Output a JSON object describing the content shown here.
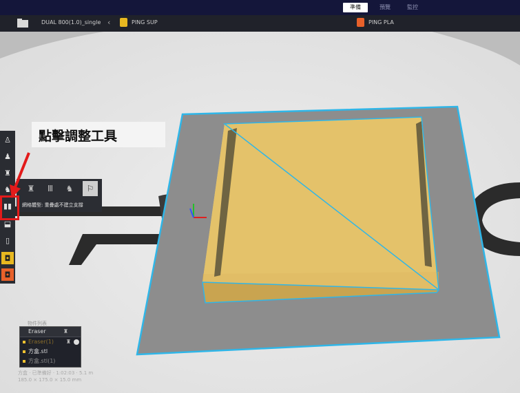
{
  "stage_tabs": [
    "準備",
    "預覽",
    "監控"
  ],
  "printer_name": "DUAL 800(1.0)_single",
  "materials": [
    {
      "label": "PING SUP",
      "color": "#e8b820"
    },
    {
      "label": "PING PLA",
      "color": "#e8612a"
    }
  ],
  "callout_text": "點擊調整工具",
  "support_tool_label": "網格體型: 重疊處不建立支撐",
  "object_list": {
    "title": "物件列表",
    "header": "Eraser",
    "items": [
      "Eraser(1)",
      "方盒.stl",
      "方盒.stl(1)"
    ]
  },
  "status_lines": [
    "方盒 · 已準備好 · 1:02:03 · 5.1 m",
    "185.0 × 175.0 × 15.0 mm"
  ],
  "colors": {
    "model": "#e3c068",
    "selection": "#2fb6e8",
    "plate": "#8d8d8d",
    "highlight": "#e31b1b",
    "topbar": "#14163a"
  }
}
